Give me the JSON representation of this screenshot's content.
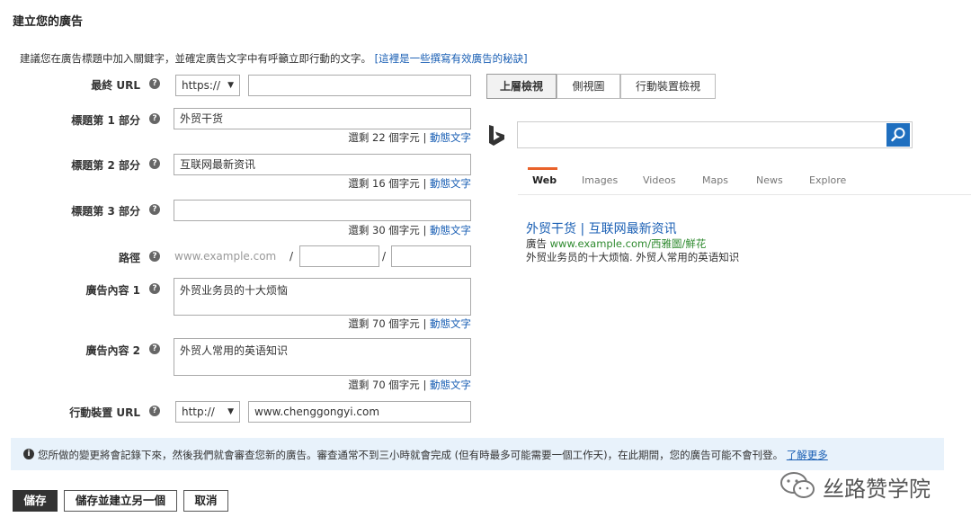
{
  "heading": "建立您的廣告",
  "intro": {
    "text": "建議您在廣告標題中加入關鍵字，並確定廣告文字中有呼籲立即行動的文字。",
    "link": "[這裡是一些撰寫有效廣告的秘訣]"
  },
  "form": {
    "final_url": {
      "label": "最終 URL",
      "protocol": "https://",
      "value": ""
    },
    "headline1": {
      "label": "標題第 1 部分",
      "value": "外贸干货",
      "remaining": "還剩 22 個字元",
      "sep": "|",
      "dynamic": "動態文字"
    },
    "headline2": {
      "label": "標題第 2 部分",
      "value": "互联网最新资讯",
      "remaining": "還剩 16 個字元",
      "sep": "|",
      "dynamic": "動態文字"
    },
    "headline3": {
      "label": "標題第 3 部分",
      "value": "",
      "remaining": "還剩 30 個字元",
      "sep": "|",
      "dynamic": "動態文字"
    },
    "path": {
      "label": "路徑",
      "domain": "www.example.com",
      "slash": "/",
      "path1": "",
      "path2": ""
    },
    "desc1": {
      "label": "廣告內容 1",
      "value": "外贸业务员的十大烦恼",
      "remaining": "還剩 70 個字元",
      "sep": "|",
      "dynamic": "動態文字"
    },
    "desc2": {
      "label": "廣告內容 2",
      "value": "外贸人常用的英语知识",
      "remaining": "還剩 70 個字元",
      "sep": "|",
      "dynamic": "動態文字"
    },
    "mobile_url": {
      "label": "行動裝置 URL",
      "protocol": "http://",
      "value": "www.chenggongyi.com"
    }
  },
  "help_icon": "?",
  "caret": "▼",
  "preview": {
    "tabs": [
      "上層檢視",
      "側視圖",
      "行動裝置檢視"
    ],
    "search_tabs": [
      "Web",
      "Images",
      "Videos",
      "Maps",
      "News",
      "Explore"
    ],
    "ad_title": "外贸干货 | 互联网最新资讯",
    "ad_badge": "廣告",
    "ad_url": "www.example.com/西雅圖/鮮花",
    "ad_desc": "外贸业务员的十大烦恼. 外贸人常用的英语知识"
  },
  "notice": {
    "icon": "i",
    "text": "您所做的變更將會記錄下來，然後我們就會審查您新的廣告。審查通常不到三小時就會完成 (但有時最多可能需要一個工作天)，在此期間，您的廣告可能不會刊登。",
    "link": "了解更多"
  },
  "buttons": {
    "save": "儲存",
    "save_new": "儲存並建立另一個",
    "cancel": "取消"
  },
  "watermark": "丝路赞学院",
  "colors": {
    "accent": "#1a5fb4",
    "bing_tab": "#e9622a",
    "notice_bg": "#e8f2fb",
    "ad_url_green": "#2f8a2f"
  }
}
